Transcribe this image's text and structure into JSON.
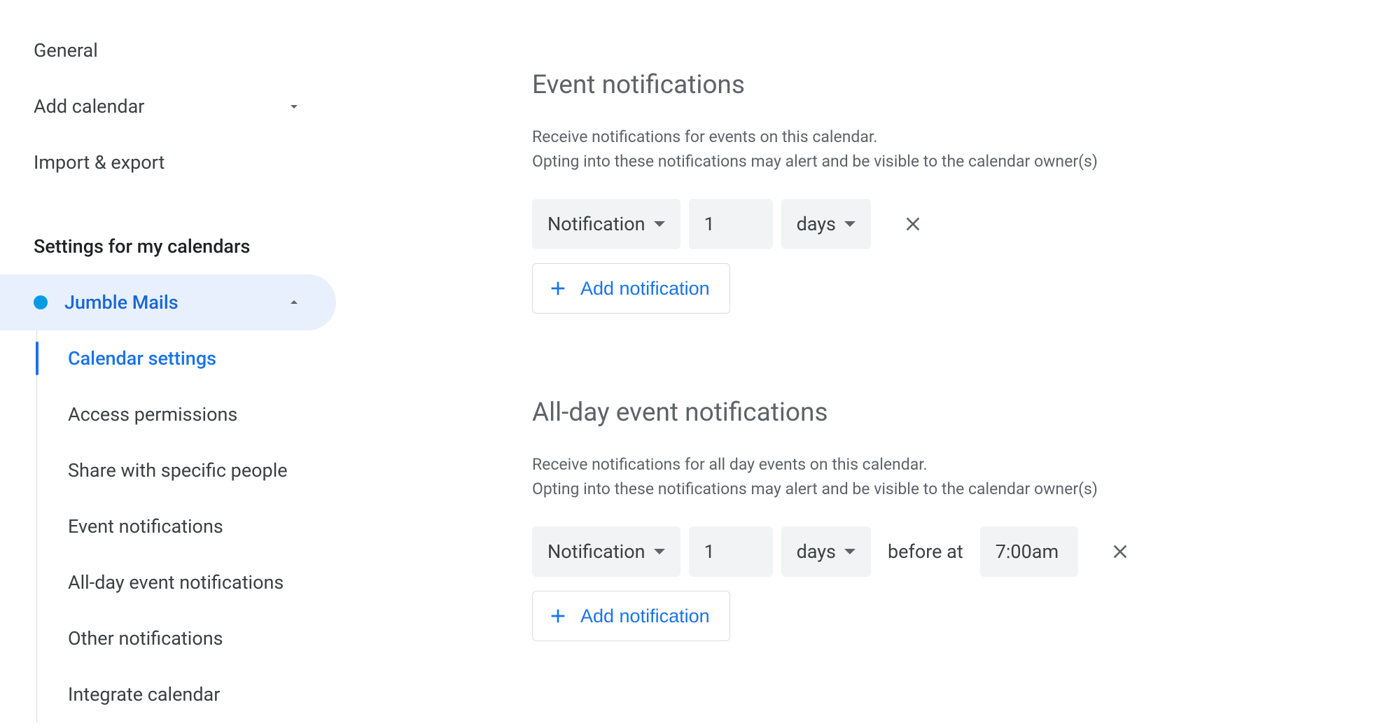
{
  "sidebar": {
    "top_items": [
      {
        "label": "General",
        "has_chevron": false
      },
      {
        "label": "Add calendar",
        "has_chevron": true
      },
      {
        "label": "Import & export",
        "has_chevron": false
      }
    ],
    "section_header": "Settings for my calendars",
    "calendar": {
      "name": "Jumble Mails",
      "color": "#039be5",
      "expanded": true,
      "items": [
        {
          "label": "Calendar settings",
          "active": true
        },
        {
          "label": "Access permissions",
          "active": false
        },
        {
          "label": "Share with specific people",
          "active": false
        },
        {
          "label": "Event notifications",
          "active": false
        },
        {
          "label": "All-day event notifications",
          "active": false
        },
        {
          "label": "Other notifications",
          "active": false
        },
        {
          "label": "Integrate calendar",
          "active": false
        }
      ]
    }
  },
  "main": {
    "event_notifications": {
      "title": "Event notifications",
      "description_line1": "Receive notifications for events on this calendar.",
      "description_line2": "Opting into these notifications may alert and be visible to the calendar owner(s)",
      "row": {
        "method": "Notification",
        "quantity": "1",
        "unit": "days"
      },
      "add_button": "Add notification"
    },
    "allday_notifications": {
      "title": "All-day event notifications",
      "description_line1": "Receive notifications for all day events on this calendar.",
      "description_line2": "Opting into these notifications may alert and be visible to the calendar owner(s)",
      "row": {
        "method": "Notification",
        "quantity": "1",
        "unit": "days",
        "before_at_label": "before at",
        "time": "7:00am"
      },
      "add_button": "Add notification"
    }
  }
}
